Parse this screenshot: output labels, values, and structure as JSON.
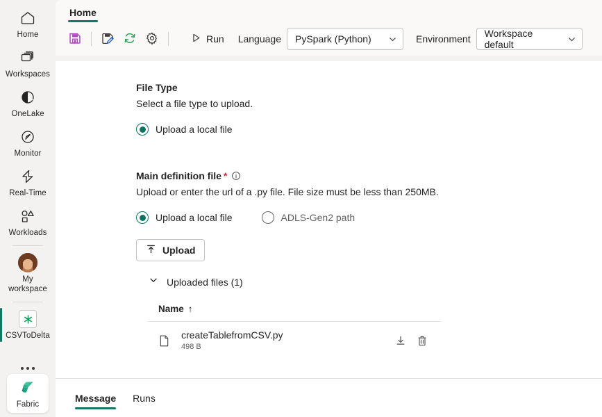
{
  "rail": {
    "items": [
      {
        "label": "Home",
        "icon": "home-icon",
        "selected": false
      },
      {
        "label": "Workspaces",
        "icon": "workspaces-icon",
        "selected": false
      },
      {
        "label": "OneLake",
        "icon": "onelake-icon",
        "selected": false
      },
      {
        "label": "Monitor",
        "icon": "monitor-icon",
        "selected": false
      },
      {
        "label": "Real-Time",
        "icon": "real-time-icon",
        "selected": false
      },
      {
        "label": "Workloads",
        "icon": "workloads-icon",
        "selected": false
      },
      {
        "label": "My workspace",
        "icon": "avatar-icon",
        "selected": false
      },
      {
        "label": "CSVToDelta",
        "icon": "spark-job-definition-icon",
        "selected": true
      }
    ],
    "more_label": "",
    "product": {
      "label": "Fabric",
      "icon": "fabric-logo-icon"
    }
  },
  "ribbon": {
    "tabs": [
      {
        "label": "Home",
        "active": true
      }
    ]
  },
  "toolbar": {
    "save_icon": "save-icon",
    "save_as_icon": "save-as-icon",
    "refresh_icon": "refresh-icon",
    "settings_icon": "gear-icon",
    "run_label": "Run",
    "run_icon": "play-icon",
    "language_label": "Language",
    "language_value": "PySpark (Python)",
    "environment_label": "Environment",
    "environment_value": "Workspace default",
    "colors": {
      "save": "#b24ac0",
      "save_as_pencil": "#185abd",
      "refresh": "#2e9e57",
      "accent": "#117865"
    }
  },
  "file_type_section": {
    "title": "File Type",
    "description": "Select a file type to upload.",
    "options": [
      {
        "label": "Upload a local file",
        "checked": true
      }
    ]
  },
  "main_definition_section": {
    "title": "Main definition file",
    "required_marker": "*",
    "info_icon": "info-icon",
    "description": "Upload or enter the url of a .py file. File size must be less than 250MB.",
    "options": [
      {
        "label": "Upload a local file",
        "checked": true
      },
      {
        "label": "ADLS-Gen2 path",
        "checked": false
      }
    ],
    "upload_button": {
      "label": "Upload",
      "icon": "upload-arrow-icon"
    },
    "uploaded_files": {
      "toggle_label": "Uploaded files (1)",
      "toggle_icon": "chevron-down-icon",
      "columns": [
        {
          "label": "Name",
          "sort": "↑"
        }
      ],
      "rows": [
        {
          "icon": "file-icon",
          "name": "createTablefromCSV.py",
          "size": "498 B",
          "actions": [
            "download-icon",
            "delete-icon"
          ]
        }
      ]
    }
  },
  "bottom_panel": {
    "tabs": [
      {
        "label": "Message",
        "active": true
      },
      {
        "label": "Runs",
        "active": false
      }
    ]
  }
}
